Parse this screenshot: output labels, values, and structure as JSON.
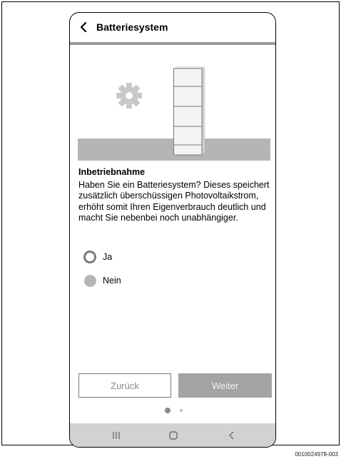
{
  "header": {
    "title": "Batteriesystem",
    "back_icon": "chevron-left-icon"
  },
  "illustration": {
    "icon": "gear-icon",
    "battery_modules": 4
  },
  "section": {
    "title": "Inbetriebnahme",
    "text": "Haben Sie ein Batteriesystem? Dieses speichert zusätzlich überschüssigen Photovoltaikstrom, erhöht somit Ihren Eigenverbrauch deutlich und macht Sie nebenbei noch unabhängiger."
  },
  "options": [
    {
      "label": "Ja",
      "selected": true
    },
    {
      "label": "Nein",
      "selected": false
    }
  ],
  "buttons": {
    "back_label": "Zurück",
    "next_label": "Weiter"
  },
  "pagination": {
    "current": 1,
    "total": 2
  },
  "navbar": {
    "icons": [
      "recents-icon",
      "home-icon",
      "back-icon"
    ]
  },
  "caption": "0010024978-003",
  "colors": {
    "accent_gray": "#9a9a9a",
    "ground": "#b5b5b5",
    "navbar": "#d2d2d2"
  }
}
